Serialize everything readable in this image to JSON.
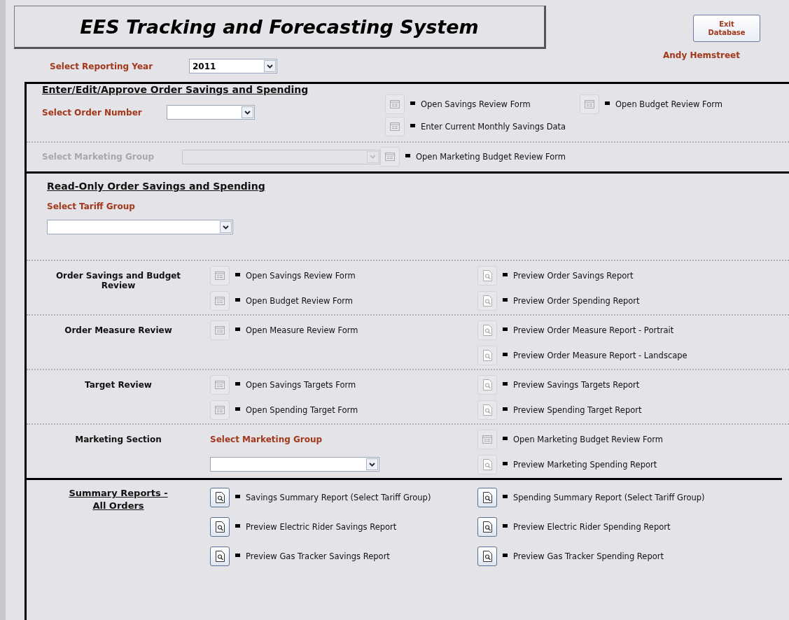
{
  "header": {
    "title": "EES Tracking and Forecasting System",
    "exit_button": "Exit Database",
    "year": {
      "label": "Select Reporting Year",
      "value": "2011"
    },
    "user": "Andy Hemstreet"
  },
  "edit_section": {
    "heading": "Enter/Edit/Approve Order Savings and Spending",
    "order": {
      "label": "Select Order Number",
      "disabled": false
    },
    "order_actions": [
      {
        "label": "Open Savings Review Form",
        "kind": "form",
        "enabled": false
      },
      {
        "label": "Open Budget Review Form",
        "kind": "form",
        "enabled": false
      },
      {
        "label": "Enter Current Monthly Savings Data",
        "kind": "form",
        "enabled": false
      }
    ],
    "marketing": {
      "label": "Select Marketing Group",
      "disabled": true
    },
    "marketing_actions": [
      {
        "label": "Open Marketing Budget Review Form",
        "kind": "form",
        "enabled": false
      }
    ]
  },
  "readonly_section": {
    "heading": "Read-Only Order Savings and Spending",
    "tariff": {
      "label": "Select Tariff Group",
      "disabled": false
    },
    "groups": [
      {
        "title": "Order Savings and Budget Review",
        "left": [
          {
            "label": "Open Savings Review Form",
            "kind": "form",
            "enabled": false
          },
          {
            "label": "Open Budget Review Form",
            "kind": "form",
            "enabled": false
          }
        ],
        "right": [
          {
            "label": "Preview Order Savings Report",
            "kind": "report",
            "enabled": false
          },
          {
            "label": "Preview Order Spending Report",
            "kind": "report",
            "enabled": false
          }
        ]
      },
      {
        "title": "Order Measure Review",
        "left": [
          {
            "label": "Open Measure Review Form",
            "kind": "form",
            "enabled": false
          }
        ],
        "right": [
          {
            "label": "Preview Order Measure Report - Portrait",
            "kind": "report",
            "enabled": false
          },
          {
            "label": "Preview Order Measure Report - Landscape",
            "kind": "report",
            "enabled": false
          }
        ]
      },
      {
        "title": "Target Review",
        "left": [
          {
            "label": "Open Savings Targets Form",
            "kind": "form",
            "enabled": false
          },
          {
            "label": "Open Spending Target Form",
            "kind": "form",
            "enabled": false
          }
        ],
        "right": [
          {
            "label": "Preview  Savings Targets Report",
            "kind": "report",
            "enabled": false
          },
          {
            "label": "Preview Spending Target Report",
            "kind": "report",
            "enabled": false
          }
        ]
      },
      {
        "title": "Marketing Section",
        "select": {
          "label": "Select Marketing Group",
          "disabled": false
        },
        "right": [
          {
            "label": "Open Marketing Budget Review Form",
            "kind": "form",
            "enabled": false
          },
          {
            "label": "Preview Marketing Spending Report",
            "kind": "report",
            "enabled": false
          }
        ]
      }
    ]
  },
  "summary_section": {
    "title": "Summary Reports - All Orders",
    "left": [
      {
        "label": "Savings Summary Report (Select Tariff Group)",
        "kind": "report",
        "enabled": true
      },
      {
        "label": "Preview Electric Rider Savings Report",
        "kind": "report",
        "enabled": true
      },
      {
        "label": "Preview Gas Tracker Savings Report",
        "kind": "report",
        "enabled": true
      }
    ],
    "right": [
      {
        "label": "Spending Summary Report (Select Tariff Group)",
        "kind": "report",
        "enabled": true
      },
      {
        "label": "Preview Electric Rider Spending Report",
        "kind": "report",
        "enabled": true
      },
      {
        "label": "Preview Gas Tracker Spending Report",
        "kind": "report",
        "enabled": true
      }
    ]
  }
}
